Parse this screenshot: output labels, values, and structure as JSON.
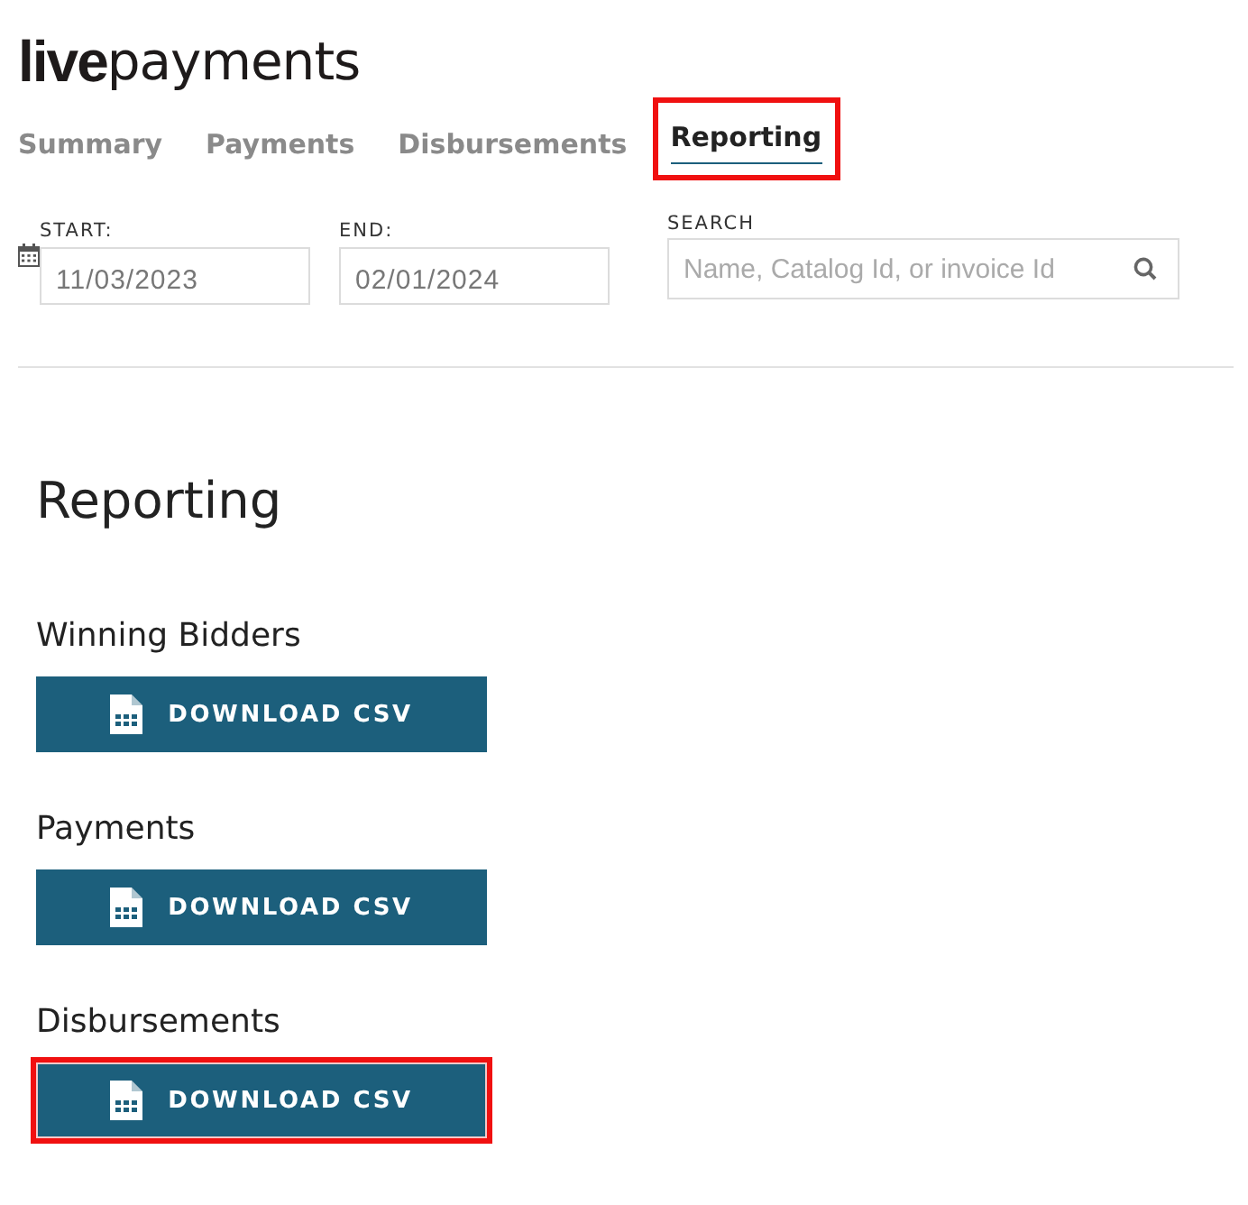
{
  "logo": {
    "bold": "live",
    "light": "payments"
  },
  "tabs": [
    {
      "label": "Summary",
      "selected": false,
      "highlighted": false
    },
    {
      "label": "Payments",
      "selected": false,
      "highlighted": false
    },
    {
      "label": "Disbursements",
      "selected": false,
      "highlighted": false
    },
    {
      "label": "Reporting",
      "selected": true,
      "highlighted": true
    }
  ],
  "filters": {
    "start": {
      "label": "START:",
      "value": "11/03/2023"
    },
    "end": {
      "label": "END:",
      "value": "02/01/2024"
    },
    "search": {
      "label": "SEARCH",
      "placeholder": "Name, Catalog Id, or invoice Id"
    }
  },
  "heading": "Reporting",
  "reports": [
    {
      "title": "Winning Bidders",
      "button": "DOWNLOAD CSV",
      "highlighted": false
    },
    {
      "title": "Payments",
      "button": "DOWNLOAD CSV",
      "highlighted": false
    },
    {
      "title": "Disbursements",
      "button": "DOWNLOAD CSV",
      "highlighted": true
    }
  ]
}
